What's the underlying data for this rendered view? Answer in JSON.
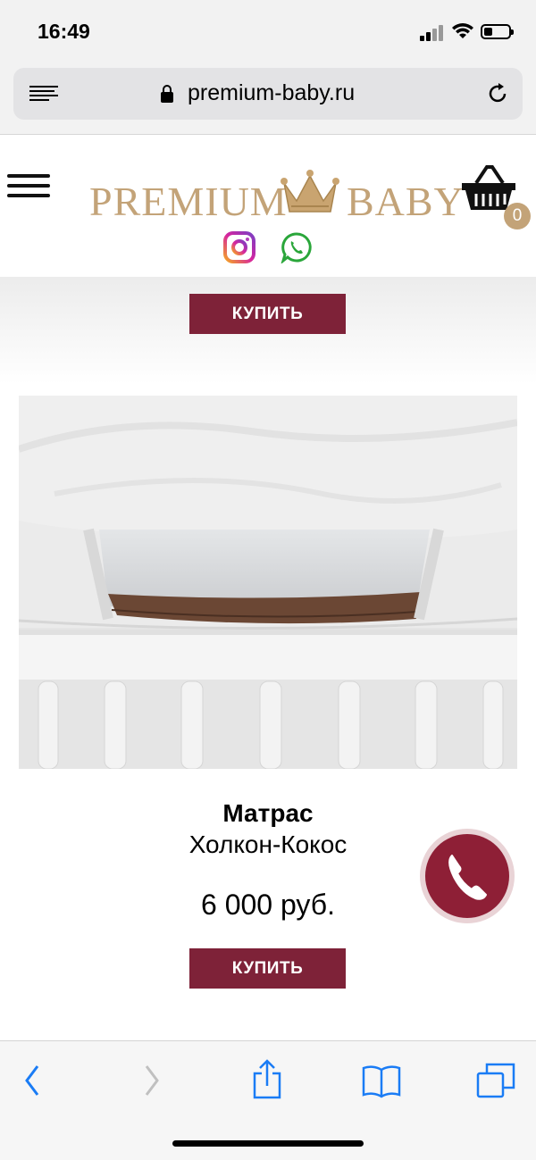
{
  "status_bar": {
    "time": "16:49"
  },
  "browser": {
    "url": "premium-baby.ru"
  },
  "header": {
    "logo_text_left": "PREMIUM",
    "logo_text_right": "BABY",
    "cart_count": "0"
  },
  "top_product": {
    "buy_label": "КУПИТЬ"
  },
  "product": {
    "title": "Матрас",
    "subtitle": "Холкон-Кокос",
    "price": "6 000 руб.",
    "buy_label": "КУПИТЬ"
  },
  "colors": {
    "accent": "#7e2238",
    "gold": "#c3a378",
    "call": "#8e1f36"
  },
  "icons": [
    "menu-icon",
    "cart-icon",
    "instagram-icon",
    "whatsapp-icon",
    "phone-icon",
    "lock-icon",
    "reload-icon",
    "reader-icon",
    "back-icon",
    "forward-icon",
    "share-icon",
    "bookmarks-icon",
    "tabs-icon"
  ]
}
